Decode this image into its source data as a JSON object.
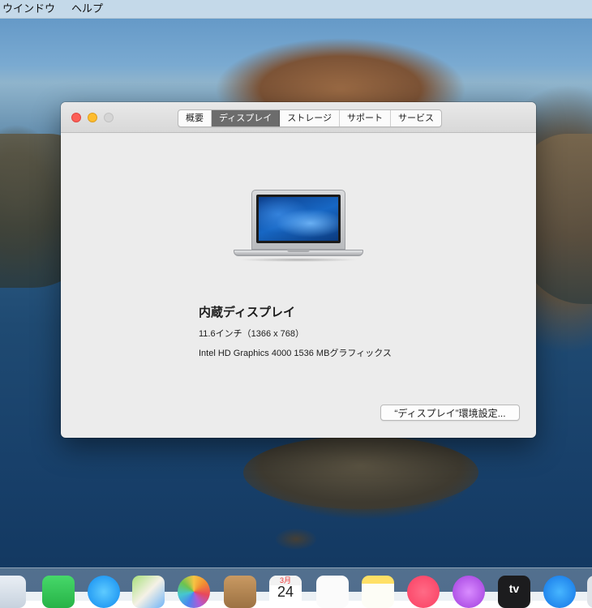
{
  "menubar": {
    "items": [
      "ウインドウ",
      "ヘルプ"
    ]
  },
  "window": {
    "tabs": [
      {
        "label": "概要",
        "selected": false
      },
      {
        "label": "ディスプレイ",
        "selected": true
      },
      {
        "label": "ストレージ",
        "selected": false
      },
      {
        "label": "サポート",
        "selected": false
      },
      {
        "label": "サービス",
        "selected": false
      }
    ],
    "display": {
      "title": "内蔵ディスプレイ",
      "size_resolution": "11.6インチ（1366 x 768）",
      "graphics": "Intel HD Graphics 4000 1536 MBグラフィックス"
    },
    "pref_button_label": "“ディスプレイ”環境設定..."
  },
  "dock": {
    "calendar_month": "3月",
    "calendar_day": "24",
    "tv_label": "tv"
  },
  "colors": {
    "traffic_close": "#fc5f57",
    "traffic_minimize": "#fdbc2e",
    "tab_selected_bg": "#6c6c6c"
  }
}
